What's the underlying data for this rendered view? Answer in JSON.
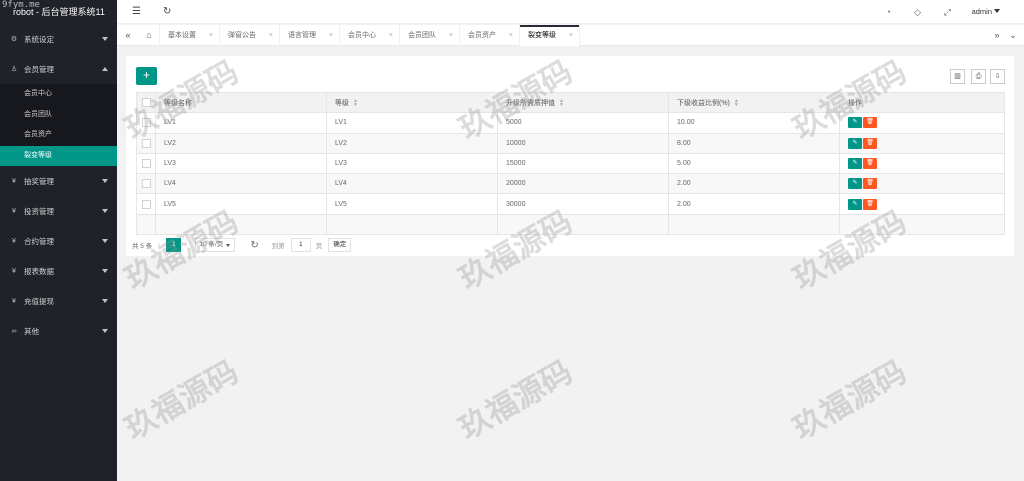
{
  "app": {
    "title": "robot - 后台管理系统11"
  },
  "sidebar": {
    "items": [
      {
        "icon": "gear-icon",
        "glyph": "⚙",
        "label": "系统设定",
        "expanded": false
      },
      {
        "icon": "user-icon",
        "glyph": "♙",
        "label": "会员管理",
        "expanded": true,
        "children": [
          {
            "label": "会员中心"
          },
          {
            "label": "会员团队"
          },
          {
            "label": "会员资产"
          },
          {
            "label": "裂变等级",
            "active": true
          }
        ]
      },
      {
        "icon": "yen-icon",
        "glyph": "¥",
        "label": "抽奖管理",
        "expanded": false
      },
      {
        "icon": "yen-icon",
        "glyph": "¥",
        "label": "投资管理",
        "expanded": false
      },
      {
        "icon": "yen-icon",
        "glyph": "¥",
        "label": "合约管理",
        "expanded": false
      },
      {
        "icon": "yen-icon",
        "glyph": "¥",
        "label": "报表数据",
        "expanded": false
      },
      {
        "icon": "yen-icon",
        "glyph": "¥",
        "label": "充值提现",
        "expanded": false
      },
      {
        "icon": "link-icon",
        "glyph": "∞",
        "label": "其他",
        "expanded": false
      }
    ]
  },
  "header": {
    "menu_icon": "☰",
    "refresh_icon": "↻",
    "theme_icon": "◔",
    "tag_icon": "◇",
    "fullscreen_icon": "⤢",
    "user": "admin"
  },
  "tabs": {
    "prev_glyph": "«",
    "next_glyph": "»",
    "more_glyph": "⌄",
    "home_glyph": "⌂",
    "close_glyph": "×",
    "items": [
      {
        "label": "基本设置"
      },
      {
        "label": "弹窗公告"
      },
      {
        "label": "语言管理"
      },
      {
        "label": "会员中心"
      },
      {
        "label": "会员团队"
      },
      {
        "label": "会员资产"
      },
      {
        "label": "裂变等级",
        "active": true
      }
    ]
  },
  "toolbar": {
    "add_glyph": "+",
    "cols_glyph": "▥",
    "print_glyph": "⎙",
    "export_glyph": "⇩"
  },
  "table": {
    "headers": [
      "等级名称",
      "等级",
      "升级所需质押值",
      "下级收益比例(%)",
      "操作"
    ],
    "rows": [
      [
        "LV1",
        "LV1",
        "5000",
        "10.00"
      ],
      [
        "LV2",
        "LV2",
        "10000",
        "8.00"
      ],
      [
        "LV3",
        "LV3",
        "15000",
        "5.00"
      ],
      [
        "LV4",
        "LV4",
        "20000",
        "2.00"
      ],
      [
        "LV5",
        "LV5",
        "30000",
        "2.00"
      ]
    ],
    "edit_glyph": "✎",
    "delete_glyph": "🗑"
  },
  "pager": {
    "total_label": "共 5 条",
    "current_page": "1",
    "prev_glyph": "‹",
    "page_size": "10 条/页",
    "refresh_glyph": "↻",
    "goto_label": "到第",
    "goto_value": "1",
    "page_label": "页",
    "confirm_label": "确定"
  },
  "watermark": {
    "text": "玖福源码",
    "corner": "9fym.me"
  },
  "colors": {
    "accent": "#009688",
    "danger": "#ff5722",
    "sidebar": "#20222a"
  }
}
